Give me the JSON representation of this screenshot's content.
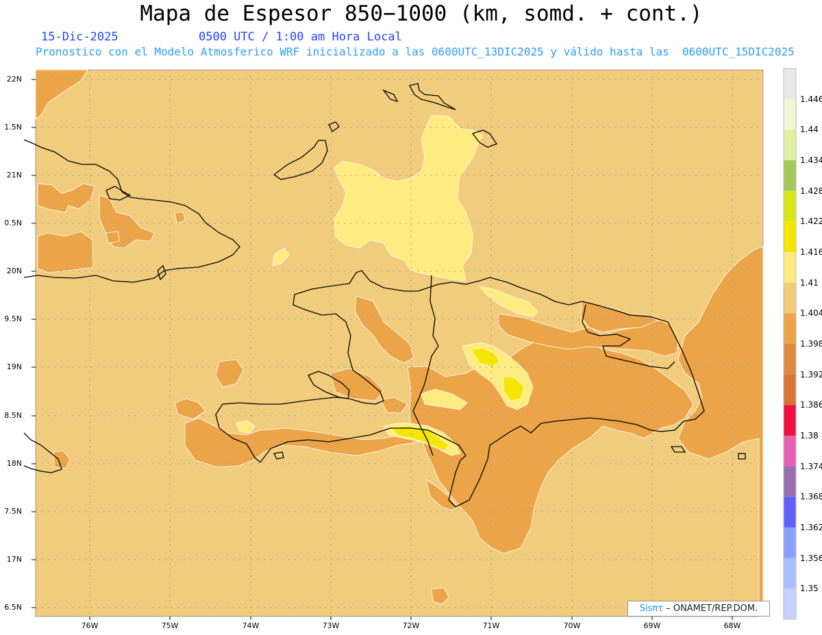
{
  "header": {
    "title": "Mapa de Espesor 850−1000 (km, somd. + cont.)",
    "date": "15-Dic-2025",
    "time": "0500 UTC / 1:00 am Hora Local",
    "model_info": "Pronostico con el Modelo Atmosferico WRF inicializado a las 0600UTC_13DIC2025 y válido hasta las  0600UTC_15DIC2025"
  },
  "axes": {
    "lat_labels": [
      "22N",
      "1.5N",
      "21N",
      "0.5N",
      "20N",
      "9.5N",
      "19N",
      "8.5N",
      "18N",
      "7.5N",
      "17N",
      "6.5N"
    ],
    "lon_labels": [
      "76W",
      "75W",
      "74W",
      "73W",
      "72W",
      "71W",
      "70W",
      "69W",
      "68W"
    ]
  },
  "colorbar": {
    "labels": [
      "1.446",
      "1.44",
      "1.434",
      "1.428",
      "1.422",
      "1.416",
      "1.41",
      "1.404",
      "1.398",
      "1.392",
      "1.386",
      "1.38",
      "1.374",
      "1.368",
      "1.362",
      "1.356",
      "1.35"
    ],
    "colors": [
      "#e8e8e8",
      "#f2f6d2",
      "#dff0a0",
      "#a6c85a",
      "#d8e616",
      "#f4e600",
      "#ffec80",
      "#f0cc7c",
      "#eca448",
      "#e08840",
      "#d8743a",
      "#f01040",
      "#e860b0",
      "#9a70b0",
      "#6060ff",
      "#8ca0ff",
      "#a8c0ff",
      "#c6d2ff"
    ]
  },
  "credit": {
    "brand": "Sisπτ",
    "org": "– ONAMET/REP.DOM."
  },
  "palette": {
    "background": "#f0cc7c",
    "orange": "#eca448",
    "light_yellow": "#ffec80",
    "yellow": "#f4e600",
    "grid": "#999999"
  }
}
